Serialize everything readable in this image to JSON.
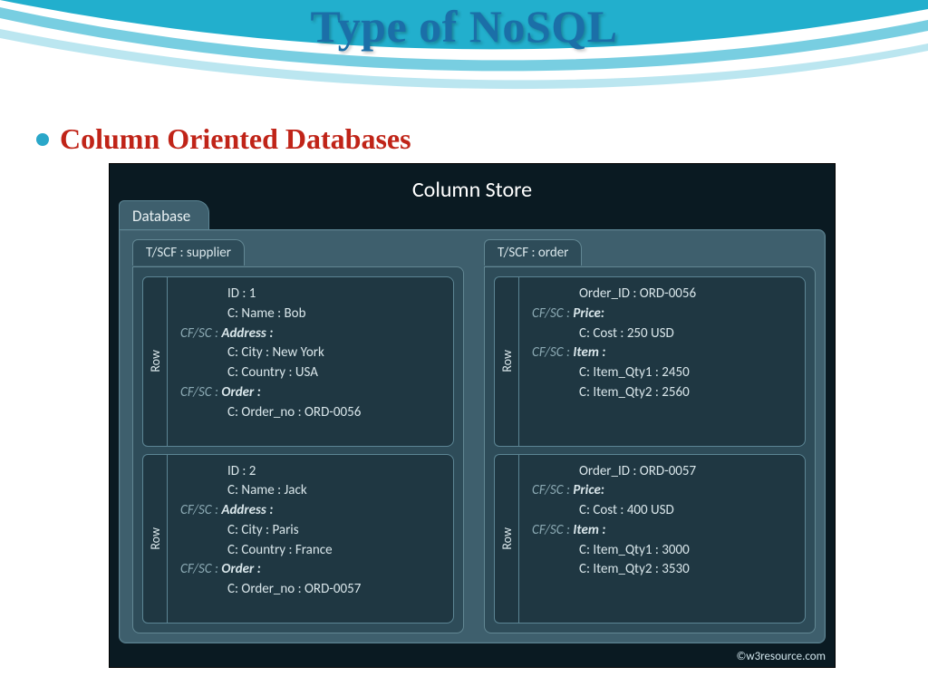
{
  "title": "Type of NoSQL",
  "bullet": "Column Oriented Databases",
  "diagram": {
    "heading": "Column Store",
    "dbTab": "Database",
    "credit": "©w3resource.com",
    "rowLabel": "Row",
    "left": {
      "scf": "T/SCF : supplier",
      "rows": [
        {
          "lines": [
            {
              "indent": true,
              "text": "ID : 1"
            },
            {
              "indent": true,
              "text": "C: Name : Bob"
            },
            {
              "cf": "CF/SC : ",
              "key": "Address :",
              "bold": true
            },
            {
              "indent": true,
              "text": "C: City : New York"
            },
            {
              "indent": true,
              "text": "C: Country : USA"
            },
            {
              "cf": "CF/SC : ",
              "key": "Order :",
              "bold": true
            },
            {
              "indent": true,
              "text": "C: Order_no : ORD-0056"
            }
          ]
        },
        {
          "lines": [
            {
              "indent": true,
              "text": "ID : 2"
            },
            {
              "indent": true,
              "text": "C: Name : Jack"
            },
            {
              "cf": "CF/SC : ",
              "key": "Address :",
              "bold": true
            },
            {
              "indent": true,
              "text": "C: City : Paris"
            },
            {
              "indent": true,
              "text": "C: Country : France"
            },
            {
              "cf": "CF/SC : ",
              "key": "Order :",
              "bold": true
            },
            {
              "indent": true,
              "text": "C: Order_no : ORD-0057"
            }
          ]
        }
      ]
    },
    "right": {
      "scf": "T/SCF : order",
      "rows": [
        {
          "lines": [
            {
              "indent": true,
              "text": "Order_ID : ORD-0056"
            },
            {
              "cf": "CF/SC : ",
              "key": "Price:",
              "bold": true
            },
            {
              "indent": true,
              "text": "C: Cost : 250 USD"
            },
            {
              "cf": "CF/SC : ",
              "key": "Item :",
              "bold": true
            },
            {
              "indent": true,
              "text": "C: Item_Qty1 : 2450"
            },
            {
              "indent": true,
              "text": "C: Item_Qty2 : 2560"
            }
          ]
        },
        {
          "lines": [
            {
              "indent": true,
              "text": "Order_ID : ORD-0057"
            },
            {
              "cf": "CF/SC : ",
              "key": "Price:",
              "bold": true
            },
            {
              "indent": true,
              "text": "C: Cost : 400 USD"
            },
            {
              "cf": "CF/SC : ",
              "key": "Item :",
              "bold": true
            },
            {
              "indent": true,
              "text": "C: Item_Qty1 : 3000"
            },
            {
              "indent": true,
              "text": "C: Item_Qty2 : 3530"
            }
          ]
        }
      ]
    }
  }
}
